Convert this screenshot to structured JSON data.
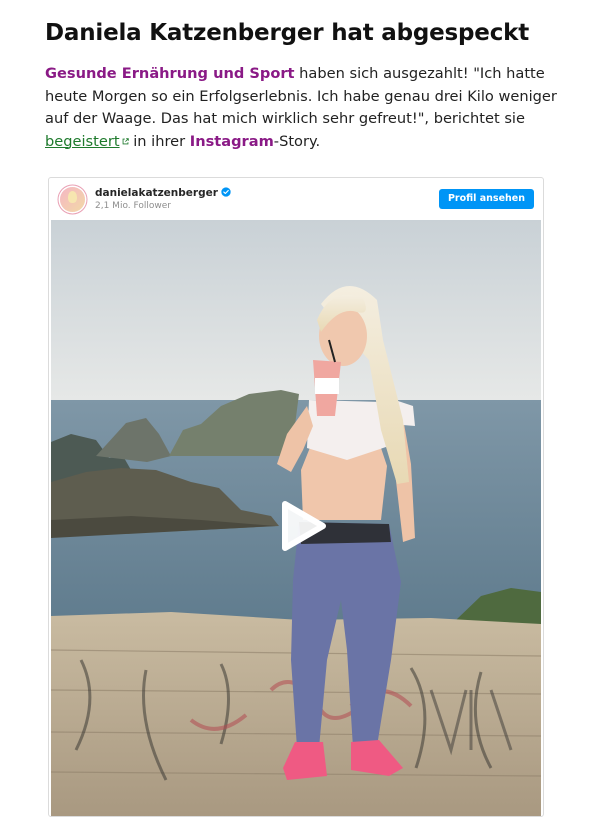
{
  "article": {
    "headline": "Daniela Katzenberger hat abgespeckt",
    "paragraph": {
      "link1": "Gesunde Ernährung und Sport",
      "text1": " haben sich ausgezahlt! \"Ich hatte heute Morgen so ein Erfolgserlebnis. Ich habe genau drei Kilo weniger auf der Waage. Das hat mich wirklich sehr gefreut!\", berichtet sie ",
      "link2": "begeistert",
      "text2": " in ihrer ",
      "link3": "Instagram",
      "text3": "-Story."
    }
  },
  "instagram_embed": {
    "username": "danielakatzenberger",
    "followers": "2,1 Mio. Follower",
    "profile_button": "Profil ansehen",
    "icons": [
      "verified-badge-icon",
      "external-link-icon",
      "play-icon"
    ]
  },
  "colors": {
    "keyword_link": "#8a1a86",
    "external_link": "#1e7a2c",
    "instagram_button": "#0095f6"
  }
}
